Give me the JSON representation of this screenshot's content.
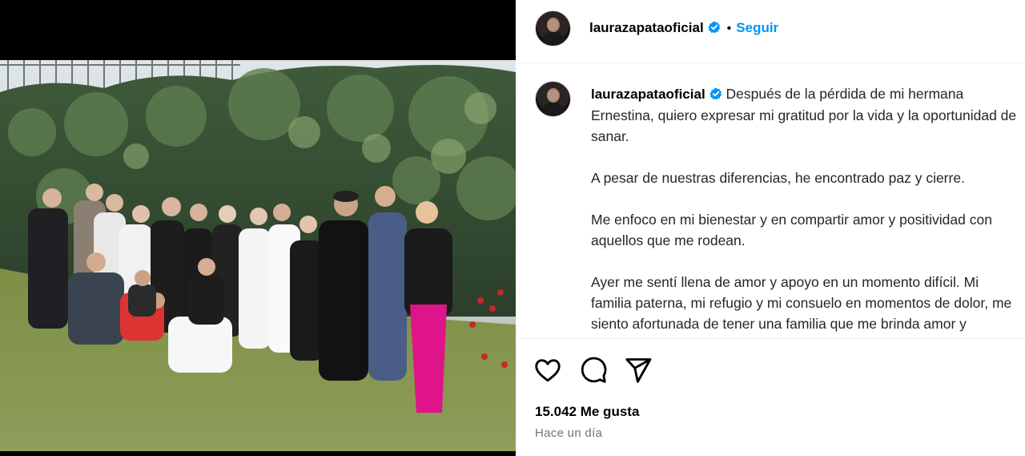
{
  "post": {
    "username": "laurazapataoficial",
    "follow_label": "Seguir",
    "separator": "•",
    "caption_paragraphs": [
      "Después de la pérdida de mi hermana Ernestina, quiero expresar mi gratitud por la vida y la oportunidad de sanar.",
      "A pesar de nuestras diferencias, he encontrado paz y cierre.",
      "Me enfoco en mi bienestar y en compartir amor y positividad con aquellos que me rodean.",
      "Ayer me sentí llena de amor y apoyo en un momento difícil. Mi familia paterna, mi refugio y mi consuelo en momentos de dolor, me siento afortunada de tener una familia que me brinda amor y consuelo."
    ],
    "likes": "15.042 Me gusta",
    "timestamp": "Hace un día"
  },
  "icons": {
    "like": "heart-icon",
    "comment": "comment-icon",
    "share": "share-icon",
    "verified": "verified-badge-icon"
  },
  "colors": {
    "follow": "#0095f6",
    "verified": "#0095f6",
    "divider": "#efefef",
    "muted": "#737373"
  }
}
